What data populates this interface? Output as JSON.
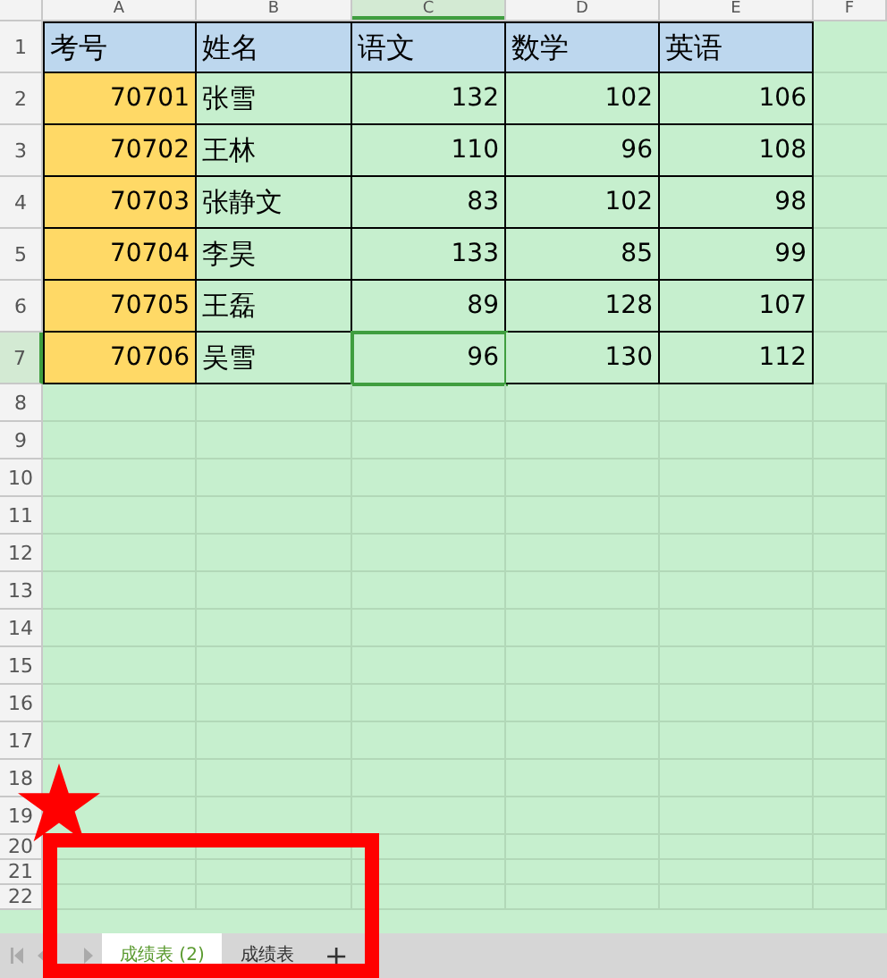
{
  "columns": [
    {
      "label": "A",
      "selected": false
    },
    {
      "label": "B",
      "selected": false
    },
    {
      "label": "C",
      "selected": true
    },
    {
      "label": "D",
      "selected": false
    },
    {
      "label": "E",
      "selected": false
    },
    {
      "label": "F",
      "selected": false
    }
  ],
  "rows": [
    {
      "header": "1",
      "selected": false,
      "cells": [
        {
          "text": "考号",
          "kind": "header",
          "selected": false
        },
        {
          "text": "姓名",
          "kind": "header",
          "selected": false
        },
        {
          "text": "语文",
          "kind": "header",
          "selected": false
        },
        {
          "text": "数学",
          "kind": "header",
          "selected": false
        },
        {
          "text": "英语",
          "kind": "header",
          "selected": false
        }
      ]
    },
    {
      "header": "2",
      "selected": false,
      "cells": [
        {
          "text": "70701",
          "kind": "id",
          "selected": false
        },
        {
          "text": "张雪",
          "kind": "text",
          "selected": false
        },
        {
          "text": "132",
          "kind": "number",
          "selected": false
        },
        {
          "text": "102",
          "kind": "number",
          "selected": false
        },
        {
          "text": "106",
          "kind": "number",
          "selected": false
        }
      ]
    },
    {
      "header": "3",
      "selected": false,
      "cells": [
        {
          "text": "70702",
          "kind": "id",
          "selected": false
        },
        {
          "text": "王林",
          "kind": "text",
          "selected": false
        },
        {
          "text": "110",
          "kind": "number",
          "selected": false
        },
        {
          "text": "96",
          "kind": "number",
          "selected": false
        },
        {
          "text": "108",
          "kind": "number",
          "selected": false
        }
      ]
    },
    {
      "header": "4",
      "selected": false,
      "cells": [
        {
          "text": "70703",
          "kind": "id",
          "selected": false
        },
        {
          "text": "张静文",
          "kind": "text",
          "selected": false
        },
        {
          "text": "83",
          "kind": "number",
          "selected": false
        },
        {
          "text": "102",
          "kind": "number",
          "selected": false
        },
        {
          "text": "98",
          "kind": "number",
          "selected": false
        }
      ]
    },
    {
      "header": "5",
      "selected": false,
      "cells": [
        {
          "text": "70704",
          "kind": "id",
          "selected": false
        },
        {
          "text": "李昊",
          "kind": "text",
          "selected": false
        },
        {
          "text": "133",
          "kind": "number",
          "selected": false
        },
        {
          "text": "85",
          "kind": "number",
          "selected": false
        },
        {
          "text": "99",
          "kind": "number",
          "selected": false
        }
      ]
    },
    {
      "header": "6",
      "selected": false,
      "cells": [
        {
          "text": "70705",
          "kind": "id",
          "selected": false
        },
        {
          "text": "王磊",
          "kind": "text",
          "selected": false
        },
        {
          "text": "89",
          "kind": "number",
          "selected": false
        },
        {
          "text": "128",
          "kind": "number",
          "selected": false
        },
        {
          "text": "107",
          "kind": "number",
          "selected": false
        }
      ]
    },
    {
      "header": "7",
      "selected": true,
      "cells": [
        {
          "text": "70706",
          "kind": "id",
          "selected": false
        },
        {
          "text": "吴雪",
          "kind": "text",
          "selected": false
        },
        {
          "text": "96",
          "kind": "number",
          "selected": true
        },
        {
          "text": "130",
          "kind": "number",
          "selected": false
        },
        {
          "text": "112",
          "kind": "number",
          "selected": false
        }
      ]
    },
    {
      "header": "8",
      "selected": false
    },
    {
      "header": "9",
      "selected": false
    },
    {
      "header": "10",
      "selected": false
    },
    {
      "header": "11",
      "selected": false
    },
    {
      "header": "12",
      "selected": false
    },
    {
      "header": "13",
      "selected": false
    },
    {
      "header": "14",
      "selected": false
    },
    {
      "header": "15",
      "selected": false
    },
    {
      "header": "16",
      "selected": false
    },
    {
      "header": "17",
      "selected": false
    },
    {
      "header": "18",
      "selected": false
    },
    {
      "header": "19",
      "selected": false
    },
    {
      "header": "20",
      "selected": false
    },
    {
      "header": "21",
      "selected": false
    },
    {
      "header": "22",
      "selected": false
    }
  ],
  "sheet_tabs": [
    {
      "label": "成绩表 (2)",
      "selected": true
    },
    {
      "label": "成绩表",
      "selected": false
    }
  ],
  "add_sheet": "+"
}
